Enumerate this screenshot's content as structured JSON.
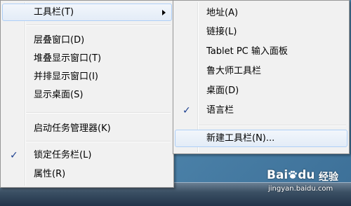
{
  "main_menu": {
    "items": [
      {
        "label": "工具栏(T)",
        "has_submenu": true,
        "highlighted": true
      },
      {
        "label": "层叠窗口(D)"
      },
      {
        "label": "堆叠显示窗口(T)"
      },
      {
        "label": "并排显示窗口(I)"
      },
      {
        "label": "显示桌面(S)"
      },
      {
        "label": "启动任务管理器(K)"
      },
      {
        "label": "锁定任务栏(L)",
        "checked": true
      },
      {
        "label": "属性(R)"
      }
    ]
  },
  "toolbars_submenu": {
    "items": [
      {
        "label": "地址(A)"
      },
      {
        "label": "链接(L)"
      },
      {
        "label": "Tablet PC 输入面板"
      },
      {
        "label": "鲁大师工具栏"
      },
      {
        "label": "桌面(D)"
      },
      {
        "label": "语言栏",
        "checked": true
      },
      {
        "label": "新建工具栏(N)...",
        "highlighted": true
      }
    ]
  },
  "check_glyph": "✓",
  "watermark": {
    "logo_text_a": "Bai",
    "logo_text_b": "du",
    "brand": "经验",
    "url": "jingyan.baidu.com"
  },
  "colors": {
    "menu_bg": "#f1f1f1",
    "hover_bg": "#e3ecf7",
    "hover_border": "#aecff7",
    "check": "#1c3f8f",
    "desktop": "#4f86ad"
  }
}
